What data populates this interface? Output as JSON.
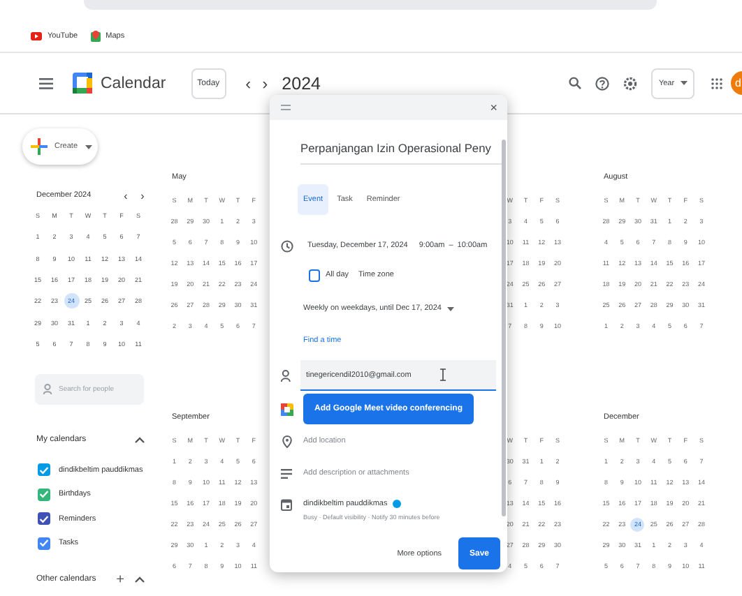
{
  "browser": {
    "bookmarks": [
      {
        "label": "YouTube",
        "kind": "video"
      },
      {
        "label": "Maps",
        "kind": "map"
      }
    ]
  },
  "header": {
    "app_name": "Calendar",
    "today_button": "Today",
    "prev": "‹",
    "next": "›",
    "period": "2024",
    "view": "Year",
    "avatar": "d"
  },
  "sidebar": {
    "create": "Create",
    "mini_calendar": {
      "title": "December 2024",
      "prev": "‹",
      "next": "›",
      "weekdays": [
        "S",
        "M",
        "T",
        "W",
        "T",
        "F",
        "S"
      ],
      "rows": [
        [
          "1",
          "2",
          "3",
          "4",
          "5",
          "6",
          "7"
        ],
        [
          "8",
          "9",
          "10",
          "11",
          "12",
          "13",
          "14"
        ],
        [
          "15",
          "16",
          "17",
          "18",
          "19",
          "20",
          "21"
        ],
        [
          "22",
          "23",
          {
            "text": "24",
            "today": true
          },
          "25",
          "26",
          "27",
          "28"
        ],
        [
          "29",
          "30",
          "31",
          "1",
          "2",
          "3",
          "4"
        ],
        [
          "5",
          "6",
          "7",
          "8",
          "9",
          "10",
          "11"
        ]
      ]
    },
    "search_placeholder": "Search for people",
    "my_calendars": {
      "title": "My calendars",
      "expanded": true,
      "items": [
        {
          "label": "dindikbeltim pauddikmas",
          "checked": true,
          "color": "#039be5"
        },
        {
          "label": "Birthdays",
          "checked": true,
          "color": "#33b679"
        },
        {
          "label": "Reminders",
          "checked": true,
          "color": "#3f51b5"
        },
        {
          "label": "Tasks",
          "checked": true,
          "color": "#4285f4"
        }
      ]
    },
    "other_calendars": {
      "title": "Other calendars",
      "add": "+",
      "expanded": true
    }
  },
  "months": [
    {
      "name": "May",
      "weekdays": [
        "S",
        "M",
        "T",
        "W",
        "T",
        "F"
      ],
      "rows": [
        [
          "28",
          "29",
          "30",
          "1",
          "2",
          "3"
        ],
        [
          "5",
          "6",
          "7",
          "8",
          "9",
          "10"
        ],
        [
          "12",
          "13",
          "14",
          "15",
          "16",
          "17"
        ],
        [
          "19",
          "20",
          "21",
          "22",
          "23",
          "24"
        ],
        [
          "26",
          "27",
          "28",
          "29",
          "30",
          "31"
        ],
        [
          "2",
          "3",
          "4",
          "5",
          "6",
          "7"
        ]
      ]
    },
    {
      "weekdays": [
        "W",
        "T",
        "F",
        "S"
      ],
      "rows": [
        [
          "3",
          "4",
          "5",
          "6"
        ],
        [
          "10",
          "11",
          "12",
          "13"
        ],
        [
          "17",
          "18",
          "19",
          "20"
        ],
        [
          "24",
          "25",
          "26",
          "27"
        ],
        [
          "31",
          "1",
          "2",
          "3"
        ],
        [
          "7",
          "8",
          "9",
          "10"
        ]
      ]
    },
    {
      "name": "August",
      "weekdays": [
        "S",
        "M",
        "T",
        "W",
        "T",
        "F",
        "S"
      ],
      "rows": [
        [
          "28",
          "29",
          "30",
          "31",
          "1",
          "2",
          "3"
        ],
        [
          "4",
          "5",
          "6",
          "7",
          "8",
          "9",
          "10"
        ],
        [
          "11",
          "12",
          "13",
          "14",
          "15",
          "16",
          "17"
        ],
        [
          "18",
          "19",
          "20",
          "21",
          "22",
          "23",
          "24"
        ],
        [
          "25",
          "26",
          "27",
          "28",
          "29",
          "30",
          "31"
        ],
        [
          "1",
          "2",
          "3",
          "4",
          "5",
          "6",
          "7"
        ]
      ]
    },
    {
      "name": "September",
      "weekdays": [
        "S",
        "M",
        "T",
        "W",
        "T",
        "F"
      ],
      "rows": [
        [
          "1",
          "2",
          "3",
          "4",
          "5",
          "6"
        ],
        [
          "8",
          "9",
          "10",
          "11",
          "12",
          "13"
        ],
        [
          "15",
          "16",
          "17",
          "18",
          "19",
          "20"
        ],
        [
          "22",
          "23",
          "24",
          "25",
          "26",
          "27"
        ],
        [
          "29",
          "30",
          "1",
          "2",
          "3",
          "4"
        ],
        [
          "6",
          "7",
          "8",
          "9",
          "10",
          "11"
        ]
      ]
    },
    {
      "weekdays": [
        "W",
        "T",
        "F",
        "S"
      ],
      "rows": [
        [
          "30",
          "31",
          "1",
          "2"
        ],
        [
          "6",
          "7",
          "8",
          "9"
        ],
        [
          "13",
          "14",
          "15",
          "16"
        ],
        [
          "20",
          "21",
          "22",
          "23"
        ],
        [
          "27",
          "28",
          "29",
          "30"
        ],
        [
          "4",
          "5",
          "6",
          "7"
        ]
      ]
    },
    {
      "name": "December",
      "weekdays": [
        "S",
        "M",
        "T",
        "W",
        "T",
        "F",
        "S"
      ],
      "rows": [
        [
          "1",
          "2",
          "3",
          "4",
          "5",
          "6",
          "7"
        ],
        [
          "8",
          "9",
          "10",
          "11",
          "12",
          "13",
          "14"
        ],
        [
          "15",
          "16",
          "17",
          "18",
          "19",
          "20",
          "21"
        ],
        [
          "22",
          "23",
          {
            "text": "24",
            "today": true
          },
          "25",
          "26",
          "27",
          "28"
        ],
        [
          "29",
          "30",
          "31",
          "1",
          "2",
          "3",
          "4"
        ],
        [
          "5",
          "6",
          "7",
          "8",
          "9",
          "10",
          "11"
        ]
      ]
    }
  ],
  "dialog": {
    "close": "×",
    "title": "Perpanjangan Izin Operasional Peny",
    "tabs": [
      {
        "label": "Event",
        "selected": true
      },
      {
        "label": "Task",
        "selected": false
      },
      {
        "label": "Reminder",
        "selected": false
      }
    ],
    "date": "Tuesday, December 17, 2024",
    "start": "9:00am",
    "dash": "–",
    "end": "10:00am",
    "all_day": {
      "label": "All day",
      "checked": false
    },
    "time_zone": "Time zone",
    "recurrence": "Weekly on weekdays, until Dec 17, 2024",
    "find_time": "Find a time",
    "guests": {
      "value": "tinegericendil2010@gmail.com"
    },
    "meet_button": "Add Google Meet video conferencing",
    "location_placeholder": "Add location",
    "description_placeholder": "Add description or attachments",
    "calendar": {
      "name": "dindikbeltim pauddikmas",
      "color": "#039be5",
      "details": "Busy · Default visibility · Notify 30 minutes before"
    },
    "more_options": "More options",
    "save": "Save"
  }
}
